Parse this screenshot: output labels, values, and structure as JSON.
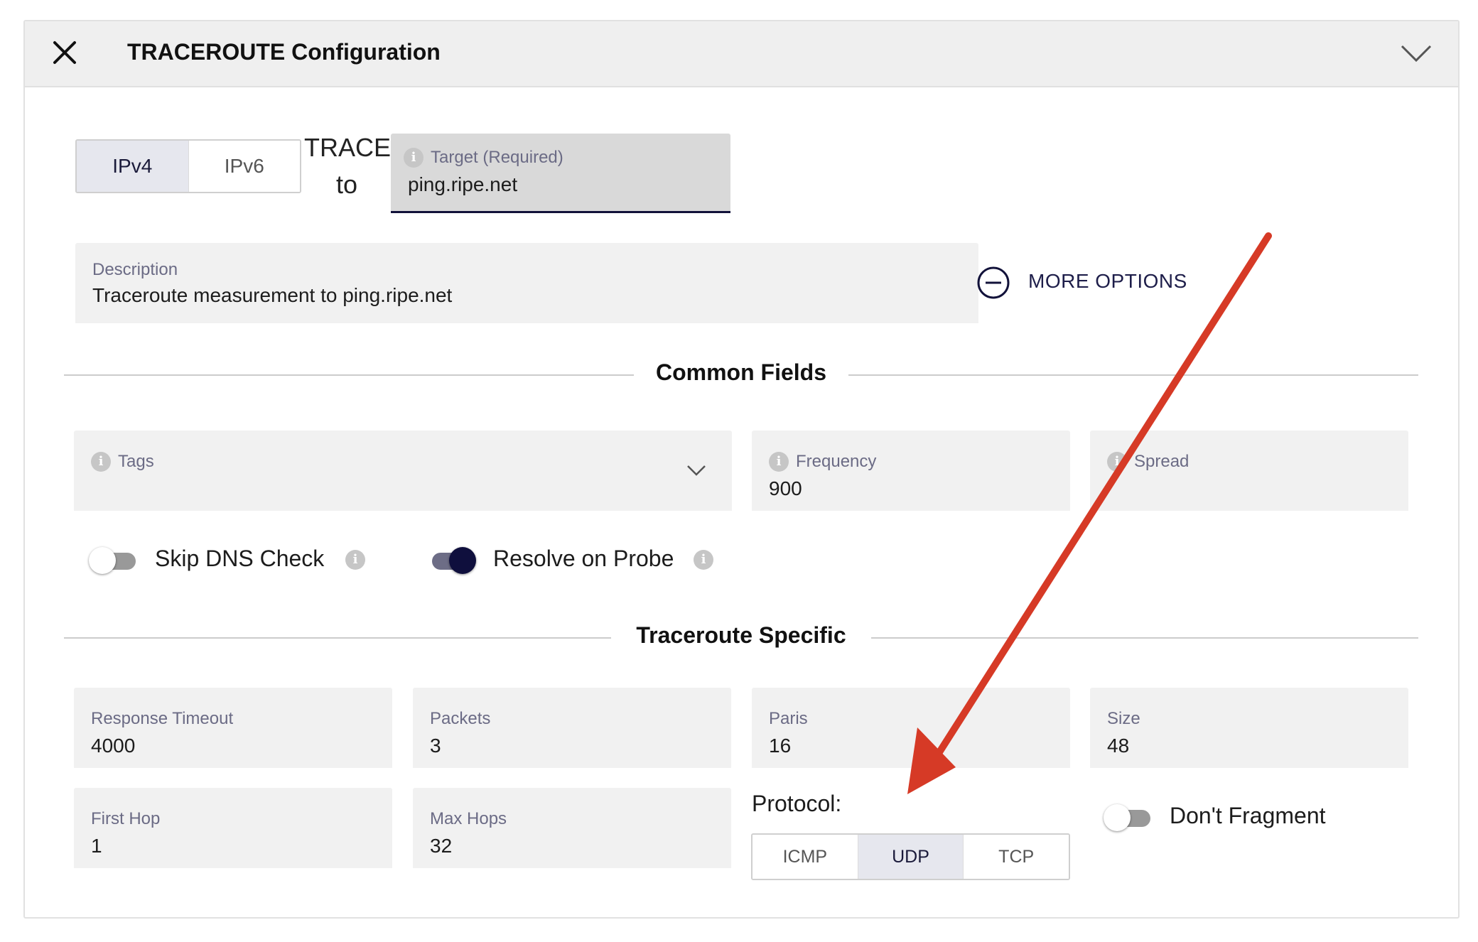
{
  "header": {
    "title": "TRACEROUTE Configuration"
  },
  "ip_version": {
    "options": [
      "IPv4",
      "IPv6"
    ],
    "selected": "IPv4"
  },
  "trace_label": {
    "line1": "TRACE",
    "line2": "to"
  },
  "target": {
    "label": "Target (Required)",
    "value": "ping.ripe.net"
  },
  "description": {
    "label": "Description",
    "value": "Traceroute measurement to ping.ripe.net"
  },
  "more_options": {
    "label": "MORE OPTIONS"
  },
  "common_fields": {
    "title": "Common Fields",
    "tags": {
      "label": "Tags",
      "value": ""
    },
    "frequency": {
      "label": "Frequency",
      "value": "900"
    },
    "spread": {
      "label": "Spread",
      "value": ""
    },
    "skip_dns_check": {
      "label": "Skip DNS Check",
      "enabled": false
    },
    "resolve_on_probe": {
      "label": "Resolve on Probe",
      "enabled": true
    }
  },
  "traceroute_specific": {
    "title": "Traceroute Specific",
    "response_timeout": {
      "label": "Response Timeout",
      "value": "4000"
    },
    "packets": {
      "label": "Packets",
      "value": "3"
    },
    "paris": {
      "label": "Paris",
      "value": "16"
    },
    "size": {
      "label": "Size",
      "value": "48"
    },
    "first_hop": {
      "label": "First Hop",
      "value": "1"
    },
    "max_hops": {
      "label": "Max Hops",
      "value": "32"
    },
    "protocol": {
      "label": "Protocol:",
      "options": [
        "ICMP",
        "UDP",
        "TCP"
      ],
      "selected": "UDP"
    },
    "dont_fragment": {
      "label": "Don't Fragment",
      "enabled": false
    }
  },
  "colors": {
    "accent": "#12123a",
    "annotation_arrow": "#d63a26",
    "field_bg": "#f1f1f1"
  }
}
